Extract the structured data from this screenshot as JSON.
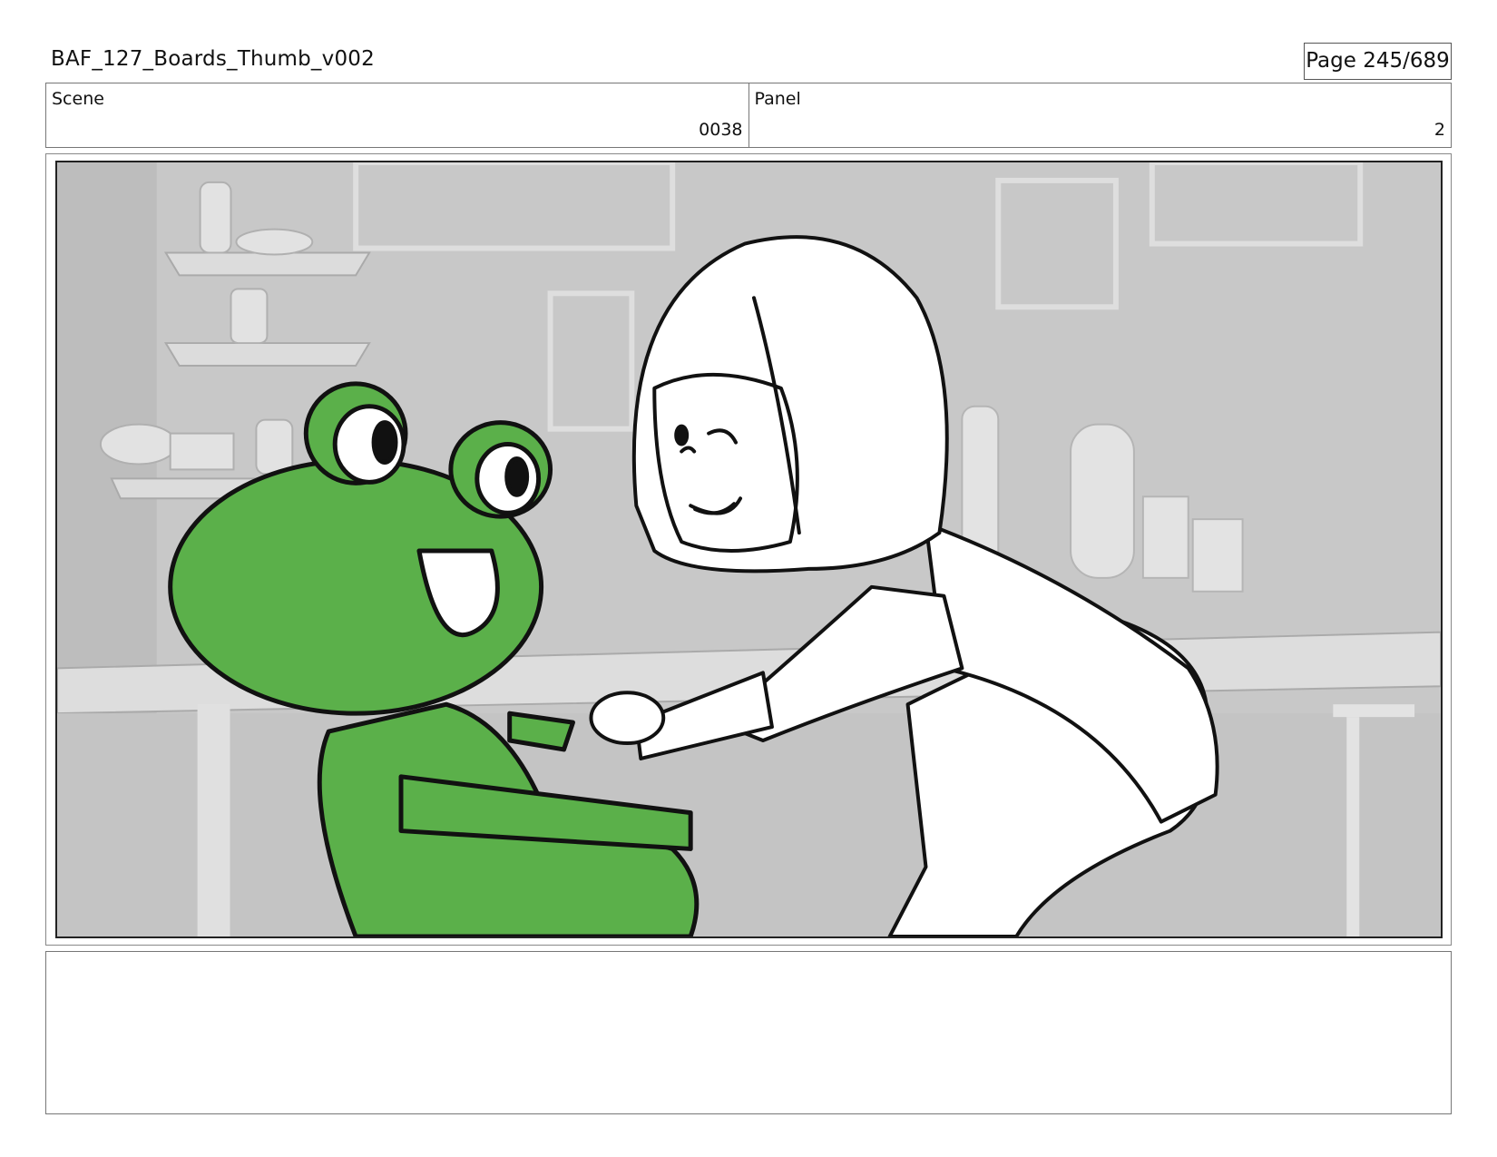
{
  "header": {
    "title": "BAF_127_Boards_Thumb_v002",
    "page": "Page 245/689"
  },
  "info": {
    "scene_label": "Scene",
    "scene_value": "0038",
    "panel_label": "Panel",
    "panel_value": "2"
  },
  "panel_image": {
    "description": "frog-and-girl-sketch",
    "frog_color": "#5bb04a",
    "background_color": "#c9c9c9"
  },
  "notes": {
    "text": ""
  }
}
